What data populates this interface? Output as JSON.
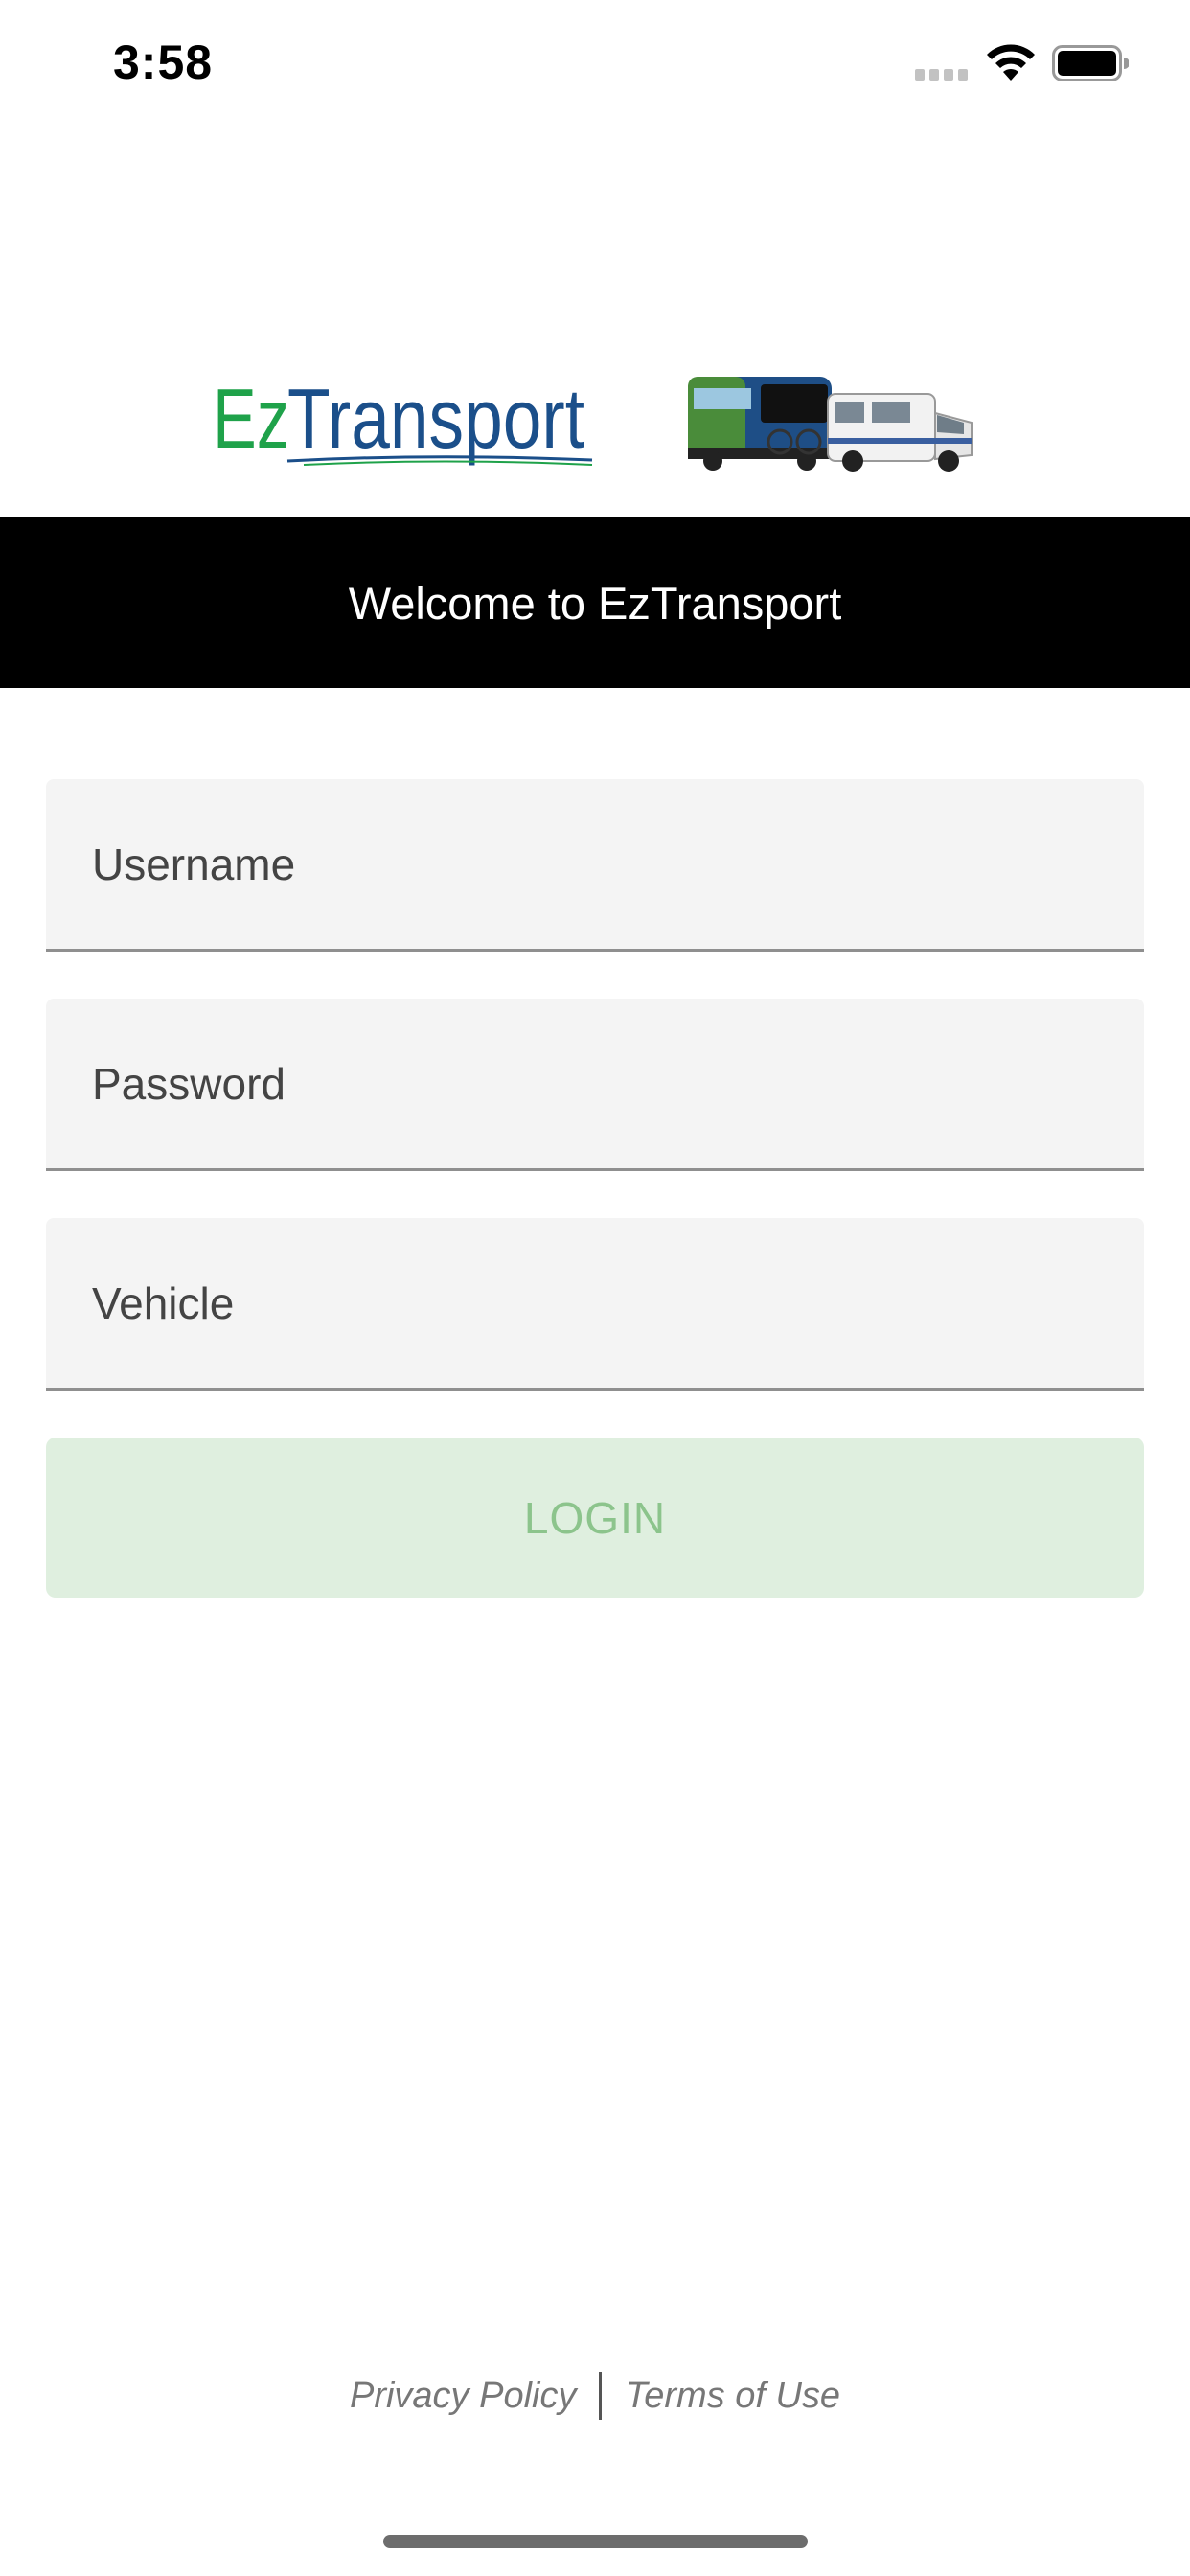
{
  "status_bar": {
    "time": "3:58",
    "icons": [
      "signal-icon",
      "wifi-icon",
      "battery-icon"
    ]
  },
  "logo": {
    "text": "EzTransport",
    "icon": "bus-and-van-illustration",
    "colors": {
      "ez": "#1fa24a",
      "transport": "#1b4f8a"
    }
  },
  "banner": {
    "text": "Welcome to EzTransport"
  },
  "form": {
    "username_placeholder": "Username",
    "password_placeholder": "Password",
    "vehicle_placeholder": "Vehicle",
    "login_label": "LOGIN"
  },
  "footer": {
    "privacy_label": "Privacy Policy",
    "terms_label": "Terms of Use"
  },
  "colors": {
    "banner_bg": "#000000",
    "field_bg": "#f4f4f4",
    "login_bg": "#dfefdf",
    "login_text": "#8cc48c"
  }
}
